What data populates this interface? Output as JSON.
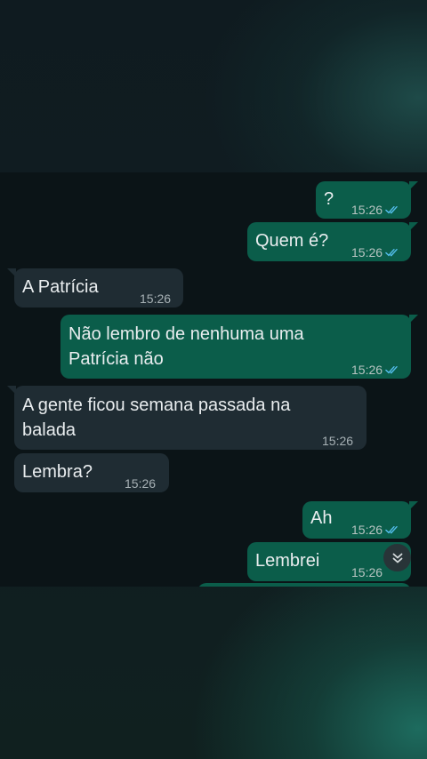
{
  "colors": {
    "incoming_bubble": "#1f2c33",
    "outgoing_bubble": "#0b5d4a",
    "chat_background": "#0b1417",
    "read_ticks": "#53bdeb"
  },
  "messages": [
    {
      "direction": "out",
      "text": "?",
      "time": "15:26",
      "status": "read"
    },
    {
      "direction": "out",
      "text": "Quem é?",
      "time": "15:26",
      "status": "read"
    },
    {
      "direction": "in",
      "text": "A Patrícia",
      "time": "15:26"
    },
    {
      "direction": "out",
      "text": "Não lembro de nenhuma uma Patrícia não",
      "time": "15:26",
      "status": "read"
    },
    {
      "direction": "in",
      "text": "A gente ficou semana passada na balada",
      "time": "15:26"
    },
    {
      "direction": "in",
      "text": "Lembra?",
      "time": "15:26"
    },
    {
      "direction": "out",
      "text": "Ah",
      "time": "15:26",
      "status": "read"
    },
    {
      "direction": "out",
      "text": "Lembrei",
      "time": "15:26"
    }
  ],
  "scroll_button": {
    "icon": "double-chevron-down-icon"
  }
}
